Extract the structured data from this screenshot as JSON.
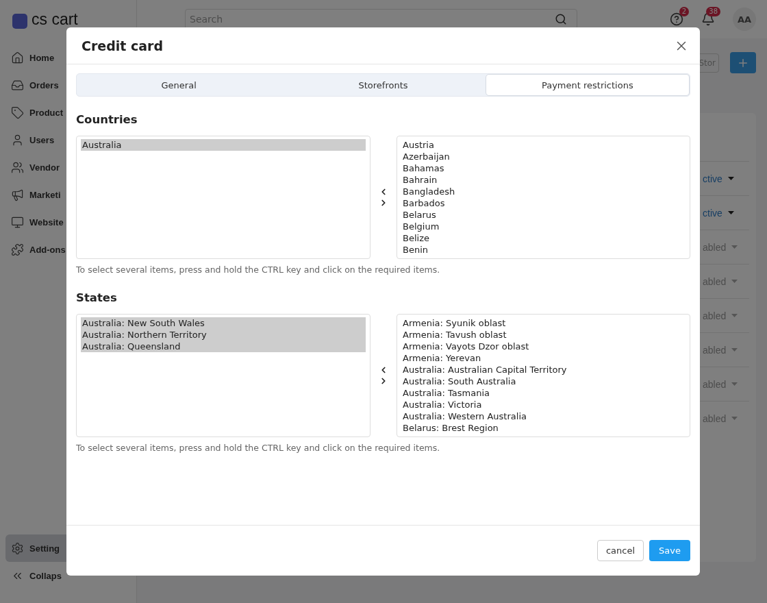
{
  "topbar": {
    "logo": "cs cart",
    "search": {
      "placeholder": "Search"
    },
    "help_badge": "2",
    "notifications_badge": "38",
    "avatar": "AA"
  },
  "sidebar": {
    "items": [
      {
        "label": "Home",
        "selected": false
      },
      {
        "label": "Orders",
        "selected": false
      },
      {
        "label": "Product",
        "selected": false
      },
      {
        "label": "Users",
        "selected": false
      },
      {
        "label": "Vendor",
        "selected": false
      },
      {
        "label": "Marketi",
        "selected": false
      },
      {
        "label": "Website",
        "selected": false
      },
      {
        "label": "Add-ons",
        "selected": false
      }
    ],
    "settings": {
      "label": "Setting",
      "selected": true
    },
    "collapse": "Collaps"
  },
  "background_page": {
    "stores_button": "Stor",
    "statuses": [
      {
        "text": "ctive",
        "active": true
      },
      {
        "text": "ctive",
        "active": true
      },
      {
        "text": "abled",
        "active": false
      },
      {
        "text": "abled",
        "active": false
      },
      {
        "text": "abled",
        "active": false
      },
      {
        "text": "abled",
        "active": false
      },
      {
        "text": "abled",
        "active": false
      },
      {
        "text": "abled",
        "active": false
      }
    ]
  },
  "modal": {
    "title": "Credit card",
    "tabs": [
      {
        "label": "General",
        "selected": false
      },
      {
        "label": "Storefronts",
        "selected": false
      },
      {
        "label": "Payment restrictions",
        "selected": true
      }
    ],
    "sections": [
      {
        "heading": "Countries",
        "chosen": [
          {
            "label": "Australia",
            "selected": true
          }
        ],
        "available": [
          {
            "label": "Austria",
            "selected": false
          },
          {
            "label": "Azerbaijan",
            "selected": false
          },
          {
            "label": "Bahamas",
            "selected": false
          },
          {
            "label": "Bahrain",
            "selected": false
          },
          {
            "label": "Bangladesh",
            "selected": false
          },
          {
            "label": "Barbados",
            "selected": false
          },
          {
            "label": "Belarus",
            "selected": false
          },
          {
            "label": "Belgium",
            "selected": false
          },
          {
            "label": "Belize",
            "selected": false
          },
          {
            "label": "Benin",
            "selected": false
          }
        ],
        "hint": "To select several items, press and hold the CTRL key and click on the required items."
      },
      {
        "heading": "States",
        "chosen": [
          {
            "label": "Australia: New South Wales",
            "selected": true
          },
          {
            "label": "Australia: Northern Territory",
            "selected": true
          },
          {
            "label": "Australia: Queensland",
            "selected": true
          }
        ],
        "available": [
          {
            "label": "Armenia: Syunik oblast",
            "selected": false
          },
          {
            "label": "Armenia: Tavush oblast",
            "selected": false
          },
          {
            "label": "Armenia: Vayots Dzor oblast",
            "selected": false
          },
          {
            "label": "Armenia: Yerevan",
            "selected": false
          },
          {
            "label": "Australia: Australian Capital Territory",
            "selected": false
          },
          {
            "label": "Australia: South Australia",
            "selected": false
          },
          {
            "label": "Australia: Tasmania",
            "selected": false
          },
          {
            "label": "Australia: Victoria",
            "selected": false
          },
          {
            "label": "Australia: Western Australia",
            "selected": false
          },
          {
            "label": "Belarus: Brest Region",
            "selected": false
          }
        ],
        "hint": "To select several items, press and hold the CTRL key and click on the required items."
      }
    ],
    "cancel_button": "cancel",
    "save_button": "Save"
  }
}
